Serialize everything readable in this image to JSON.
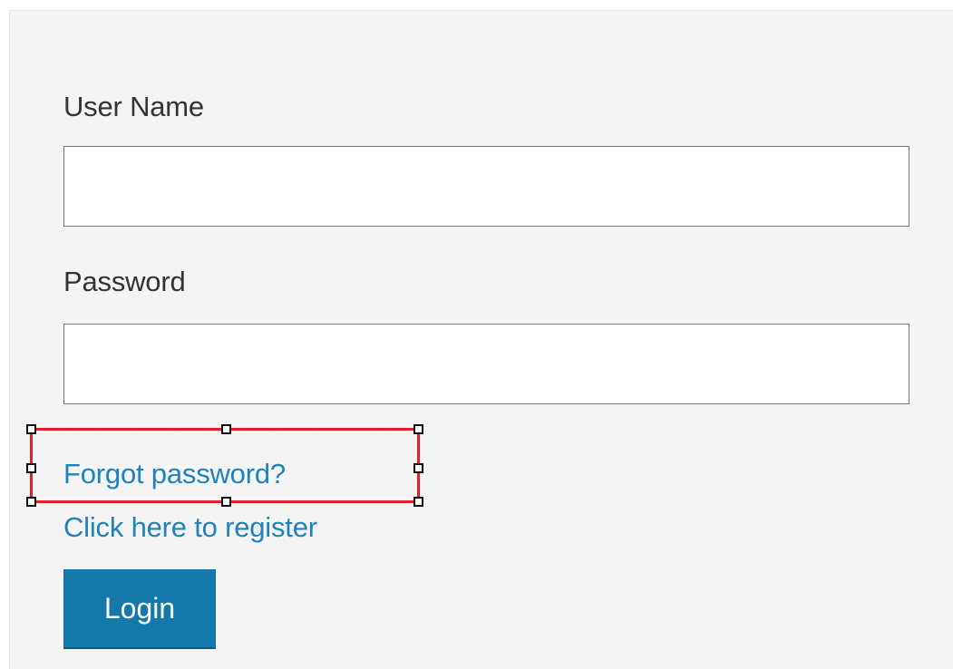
{
  "login_form": {
    "username_label": "User Name",
    "username_value": "",
    "password_label": "Password",
    "password_value": "",
    "forgot_password_link": "Forgot password?",
    "register_link": "Click here to register",
    "login_button": "Login"
  },
  "colors": {
    "panel_background": "#f4f4f4",
    "link": "#1f82b8",
    "button_background": "#1479aa",
    "button_text": "#ffffff",
    "selection_border": "#e0202a"
  },
  "selection": {
    "target": "forgot-password-link"
  }
}
